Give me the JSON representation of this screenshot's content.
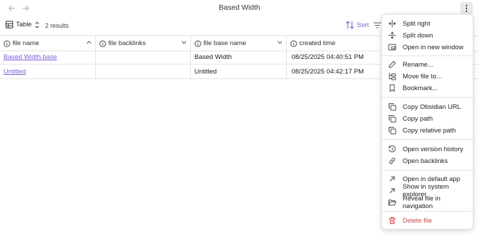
{
  "window": {
    "title": "Based Width"
  },
  "toolbar": {
    "view_label": "Table",
    "results_label": "2 results",
    "sort_label": "Sort"
  },
  "table": {
    "columns": [
      "file name",
      "file backlinks",
      "file base name",
      "created time"
    ],
    "rows": [
      {
        "name": "Based Width.base",
        "backlinks": "",
        "basename": "Based Width",
        "ctime": "08/25/2025 04:40:51 PM"
      },
      {
        "name": "Untitled",
        "backlinks": "",
        "basename": "Untitled",
        "ctime": "08/25/2025 04:42:17 PM"
      }
    ]
  },
  "menu": {
    "groups": [
      [
        {
          "label": "Split right",
          "icon": "split-right-icon"
        },
        {
          "label": "Split down",
          "icon": "split-down-icon"
        },
        {
          "label": "Open in new window",
          "icon": "new-window-icon"
        }
      ],
      [
        {
          "label": "Rename...",
          "icon": "pencil-icon"
        },
        {
          "label": "Move file to...",
          "icon": "folder-tree-icon"
        },
        {
          "label": "Bookmark...",
          "icon": "bookmark-icon"
        }
      ],
      [
        {
          "label": "Copy Obsidian URL",
          "icon": "copy-icon"
        },
        {
          "label": "Copy path",
          "icon": "copy-icon"
        },
        {
          "label": "Copy relative path",
          "icon": "copy-icon"
        }
      ],
      [
        {
          "label": "Open version history",
          "icon": "history-icon"
        },
        {
          "label": "Open backlinks",
          "icon": "links-icon"
        }
      ],
      [
        {
          "label": "Open in default app",
          "icon": "arrow-up-right-icon"
        },
        {
          "label": "Show in system explorer",
          "icon": "arrow-up-right-icon"
        },
        {
          "label": "Reveal file in navigation",
          "icon": "folder-open-icon"
        }
      ],
      [
        {
          "label": "Delete file",
          "icon": "trash-icon",
          "danger": true
        }
      ]
    ]
  },
  "colors": {
    "accent": "#7c5cd6",
    "danger": "#d04848"
  }
}
